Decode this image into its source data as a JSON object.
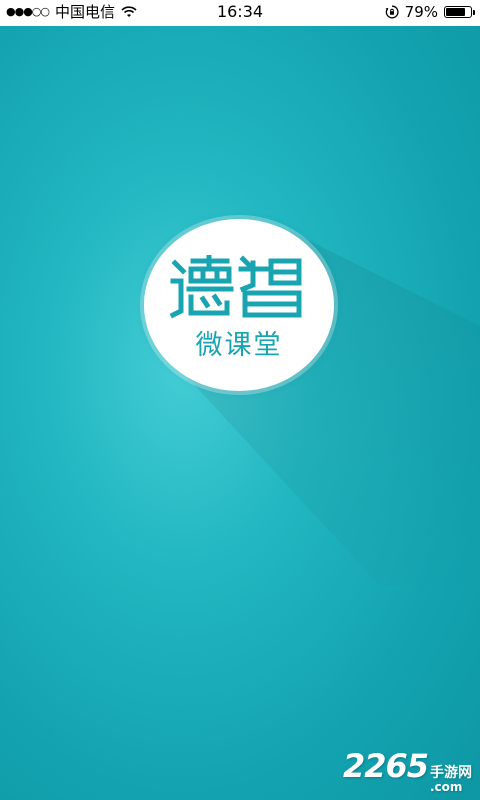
{
  "status_bar": {
    "signal": "●●●○○",
    "carrier": "中国电信",
    "time": "16:34",
    "battery_percent": "79%",
    "battery_level": 0.79,
    "icons": [
      "signal-dots",
      "wifi-icon",
      "rotation-lock-icon",
      "battery-icon"
    ]
  },
  "splash": {
    "logo_text": "德智",
    "subtitle": "微课堂",
    "colors": {
      "background": "#1aaeb9",
      "logo_teal": "#18a5b1",
      "circle": "#ffffff"
    }
  },
  "watermark": {
    "number": "2265",
    "site_cn": "手游网",
    "site_suffix": ".com"
  }
}
